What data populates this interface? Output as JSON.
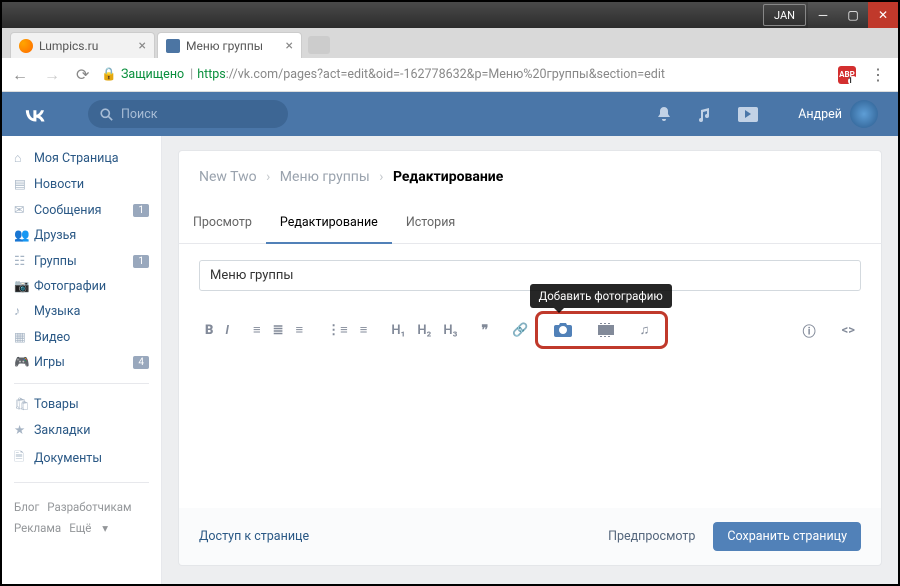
{
  "window": {
    "user_label": "JAN"
  },
  "browser": {
    "tabs": [
      {
        "title": "Lumpics.ru"
      },
      {
        "title": "Меню группы"
      }
    ],
    "secure_label": "Защищено",
    "url_proto": "https",
    "url_host": "://vk.com",
    "url_path": "/pages?act=edit&oid=-162778632&p=Меню%20группы&section=edit"
  },
  "vk_header": {
    "logo": "VK",
    "search_placeholder": "Поиск",
    "username": "Андрей"
  },
  "sidebar": {
    "items": [
      {
        "icon": "home",
        "label": "Моя Страница",
        "badge": ""
      },
      {
        "icon": "news",
        "label": "Новости",
        "badge": ""
      },
      {
        "icon": "msg",
        "label": "Сообщения",
        "badge": "1"
      },
      {
        "icon": "friends",
        "label": "Друзья",
        "badge": ""
      },
      {
        "icon": "groups",
        "label": "Группы",
        "badge": "1"
      },
      {
        "icon": "photos",
        "label": "Фотографии",
        "badge": ""
      },
      {
        "icon": "music",
        "label": "Музыка",
        "badge": ""
      },
      {
        "icon": "video",
        "label": "Видео",
        "badge": ""
      },
      {
        "icon": "games",
        "label": "Игры",
        "badge": "4"
      }
    ],
    "items2": [
      {
        "icon": "market",
        "label": "Товары"
      },
      {
        "icon": "fav",
        "label": "Закладки"
      },
      {
        "icon": "docs",
        "label": "Документы"
      }
    ],
    "footer": {
      "blog": "Блог",
      "dev": "Разработчикам",
      "ads": "Реклама",
      "more": "Ещё"
    }
  },
  "breadcrumb": {
    "lvl1": "New Two",
    "lvl2": "Меню группы",
    "lvl3": "Редактирование"
  },
  "editor_tabs": {
    "view": "Просмотр",
    "edit": "Редактирование",
    "history": "История"
  },
  "editor": {
    "title_value": "Меню группы",
    "tooltip": "Добавить фотографию",
    "h1": "H₁",
    "h2": "H₂",
    "h3": "H₃"
  },
  "footer": {
    "access": "Доступ к странице",
    "preview": "Предпросмотр",
    "save": "Сохранить страницу"
  }
}
